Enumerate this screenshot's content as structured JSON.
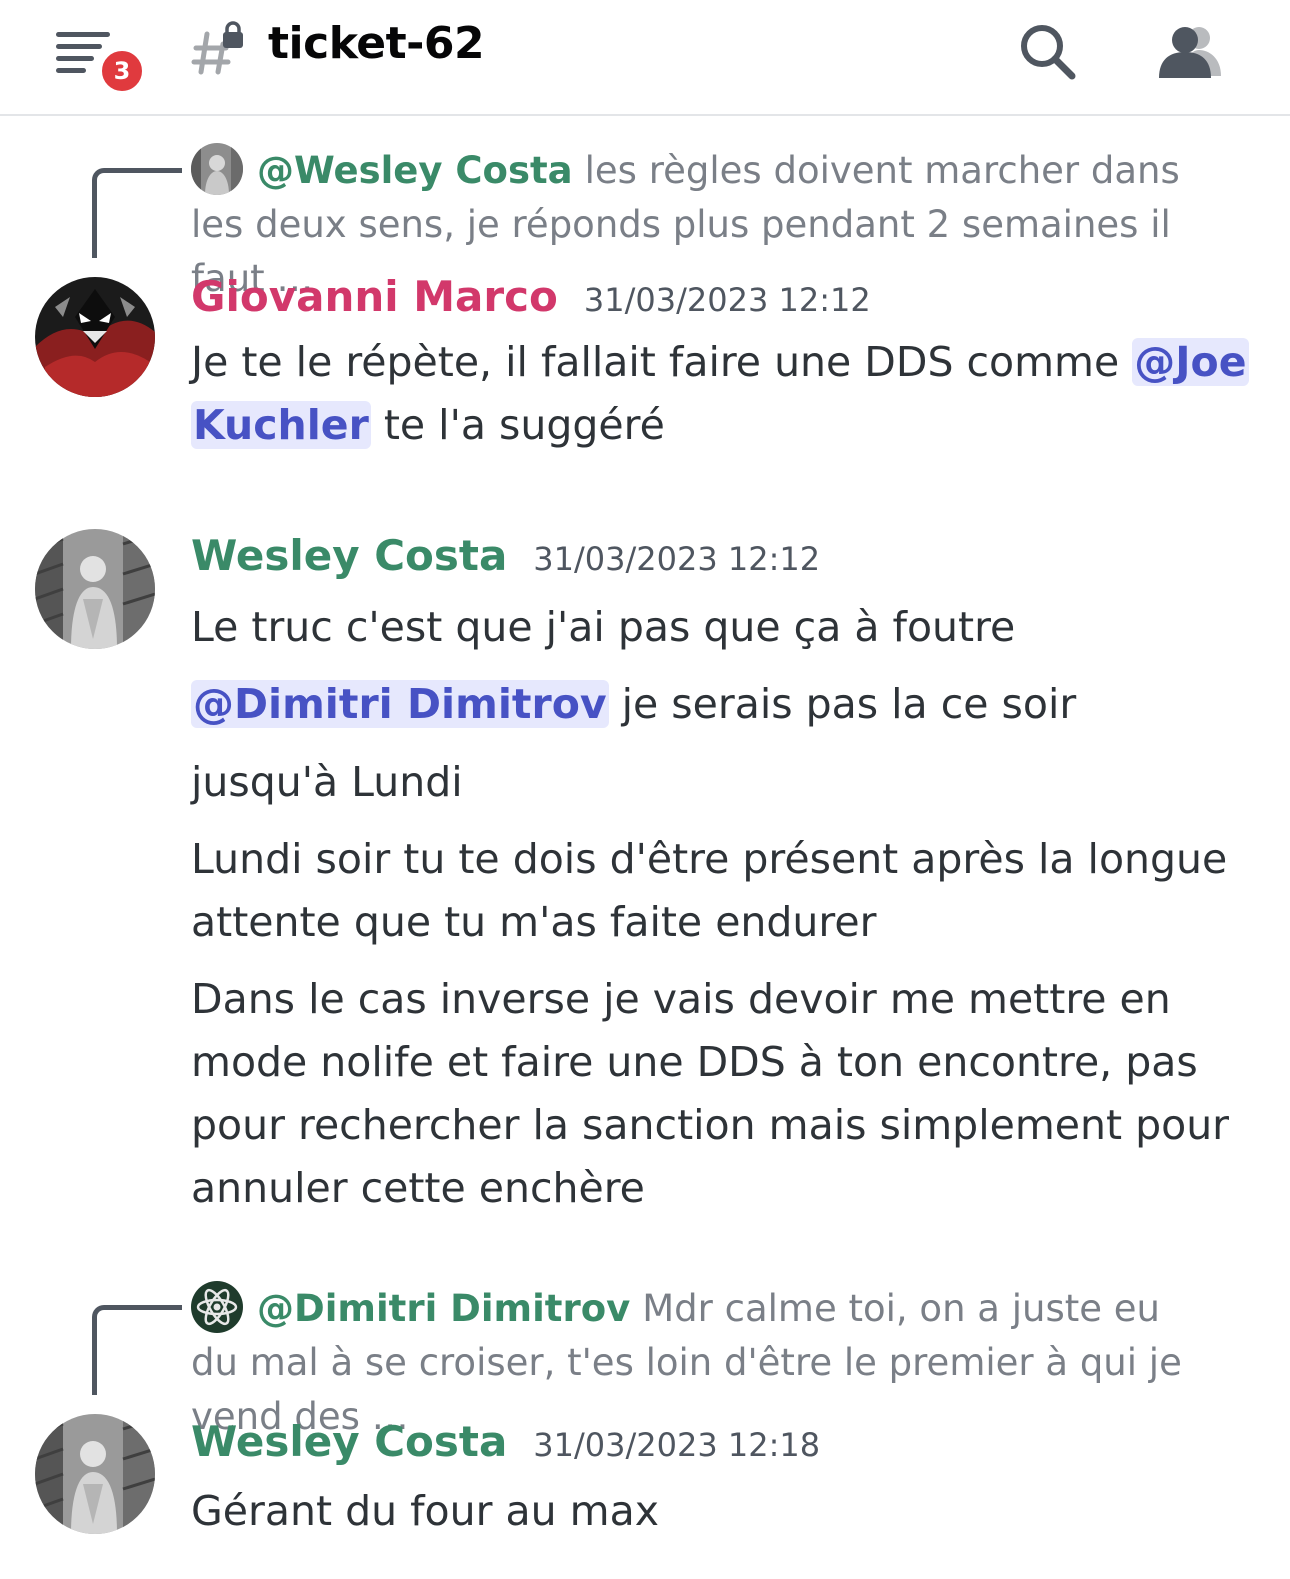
{
  "header": {
    "badge_count": "3",
    "channel_name": "ticket-62",
    "icons": [
      "menu-icon",
      "locked-channel-icon",
      "search-icon",
      "members-icon"
    ]
  },
  "messages": [
    {
      "reply": {
        "mention": "@Wesley Costa",
        "text": "les règles doivent marcher dans les deux sens, je réponds plus pendant 2 semaines il faut …"
      },
      "author": "Giovanni Marco",
      "author_color": "#d2386b",
      "timestamp": "31/03/2023 12:12",
      "lines": [
        {
          "pre": "Je te le répète, il fallait faire une DDS comme ",
          "mention_a": "@Joe",
          "mention_b": "Kuchler",
          "post": " te l'a suggéré"
        }
      ]
    },
    {
      "author": "Wesley Costa",
      "author_color": "#3a8a68",
      "timestamp": "31/03/2023 12:12",
      "lines": [
        "Le truc c'est que j'ai pas que ça à foutre",
        {
          "mention": "@Dimitri Dimitrov",
          "post": " je serais pas la ce soir"
        },
        "jusqu'à Lundi",
        "Lundi soir tu te dois d'être présent après la longue attente que tu m'as faite endurer",
        "Dans le cas inverse je vais devoir me mettre en mode nolife et faire une DDS à ton encontre, pas pour rechercher la sanction mais simplement pour annuler cette enchère"
      ]
    },
    {
      "reply": {
        "mention": "@Dimitri Dimitrov",
        "text": "Mdr calme toi, on a juste eu du mal à se croiser, t'es loin d'être le premier à qui je vend des …"
      },
      "author": "Wesley Costa",
      "author_color": "#3a8a68",
      "timestamp": "31/03/2023 12:18",
      "lines": [
        "Gérant du four au max"
      ]
    }
  ]
}
